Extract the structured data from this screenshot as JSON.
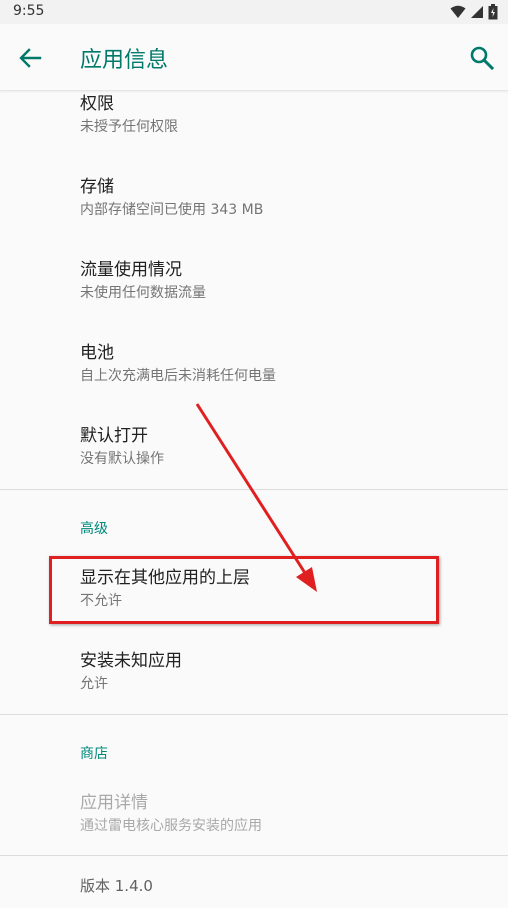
{
  "status_bar": {
    "time": "9:55"
  },
  "header": {
    "title": "应用信息"
  },
  "items": [
    {
      "title": "权限",
      "subtitle": "未授予任何权限"
    },
    {
      "title": "存储",
      "subtitle": "内部存储空间已使用 343 MB"
    },
    {
      "title": "流量使用情况",
      "subtitle": "未使用任何数据流量"
    },
    {
      "title": "电池",
      "subtitle": "自上次充满电后未消耗任何电量"
    },
    {
      "title": "默认打开",
      "subtitle": "没有默认操作"
    }
  ],
  "advanced": {
    "header": "高级",
    "items": [
      {
        "title": "显示在其他应用的上层",
        "subtitle": "不允许"
      },
      {
        "title": "安装未知应用",
        "subtitle": "允许"
      }
    ]
  },
  "store": {
    "header": "商店",
    "items": [
      {
        "title": "应用详情",
        "subtitle": "通过雷电核心服务安装的应用"
      }
    ]
  },
  "version": "版本 1.4.0",
  "colors": {
    "accent": "#00796b",
    "annotation": "#e02020"
  }
}
